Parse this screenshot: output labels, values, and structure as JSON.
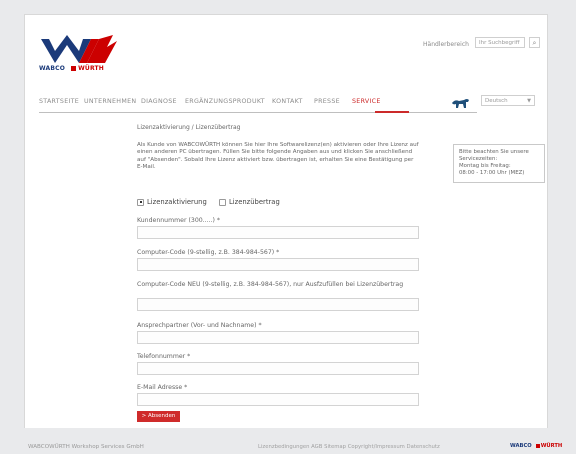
{
  "header": {
    "logo_wabco": "WABCO",
    "logo_wurth": "WÜRTH",
    "dealer_link": "Händlerbereich",
    "search_placeholder": "Ihr Suchbegriff",
    "search_icon": "search-icon"
  },
  "nav": {
    "items": [
      "STARTSEITE",
      "UNTERNEHMEN",
      "DIAGNOSE",
      "ERGÄNZUNGSPRODUKT",
      "KONTAKT",
      "PRESSE",
      "SERVICE"
    ],
    "active": "SERVICE",
    "language": "Deutsch"
  },
  "main": {
    "breadcrumb": "Lizenzaktivierung / Lizenzübertrag",
    "intro": "Als Kunde von WABCOWÜRTH können Sie hier Ihre Softwarelizenz(en) aktivieren oder Ihre Lizenz auf einen anderen PC übertragen. Füllen Sie bitte folgende Angaben aus und klicken Sie anschließend auf \"Absenden\". Sobald Ihre Lizenz aktiviert bzw. übertragen ist, erhalten Sie eine Bestätigung per E-Mail.",
    "radio_activation": "Lizenzaktivierung",
    "radio_transfer": "Lizenzübertrag",
    "fields": [
      {
        "label": "Kundennummer (300.....) *"
      },
      {
        "label": "Computer-Code (9-stellig, z.B. 384-984-567) *"
      },
      {
        "label": "Computer-Code NEU (9-stellig, z.B. 384-984-567), nur Ausfzufüllen bei Lizenzübertrag"
      },
      {
        "label": "Ansprechpartner (Vor- und Nachname) *"
      },
      {
        "label": "Telefonnummer *"
      },
      {
        "label": "E-Mail Adresse *"
      }
    ],
    "submit": "> Absenden"
  },
  "info": {
    "line1": "Bitte beachten Sie unsere",
    "line2": "Servicezeiten:",
    "line3": "Montag bis Freitag:",
    "line4": "08:00 - 17:00 Uhr (MEZ)"
  },
  "footer": {
    "company": "WABCOWÜRTH Workshop Services GmbH",
    "links": "Lizenzbedingungen   AGB   Sitemap   Copyright/Impressum   Datenschutz",
    "logo_wabco": "WABCO",
    "logo_wurth": "WÜRTH"
  },
  "colors": {
    "accent": "#cc2a2a",
    "brand_blue": "#1b3a7a"
  }
}
